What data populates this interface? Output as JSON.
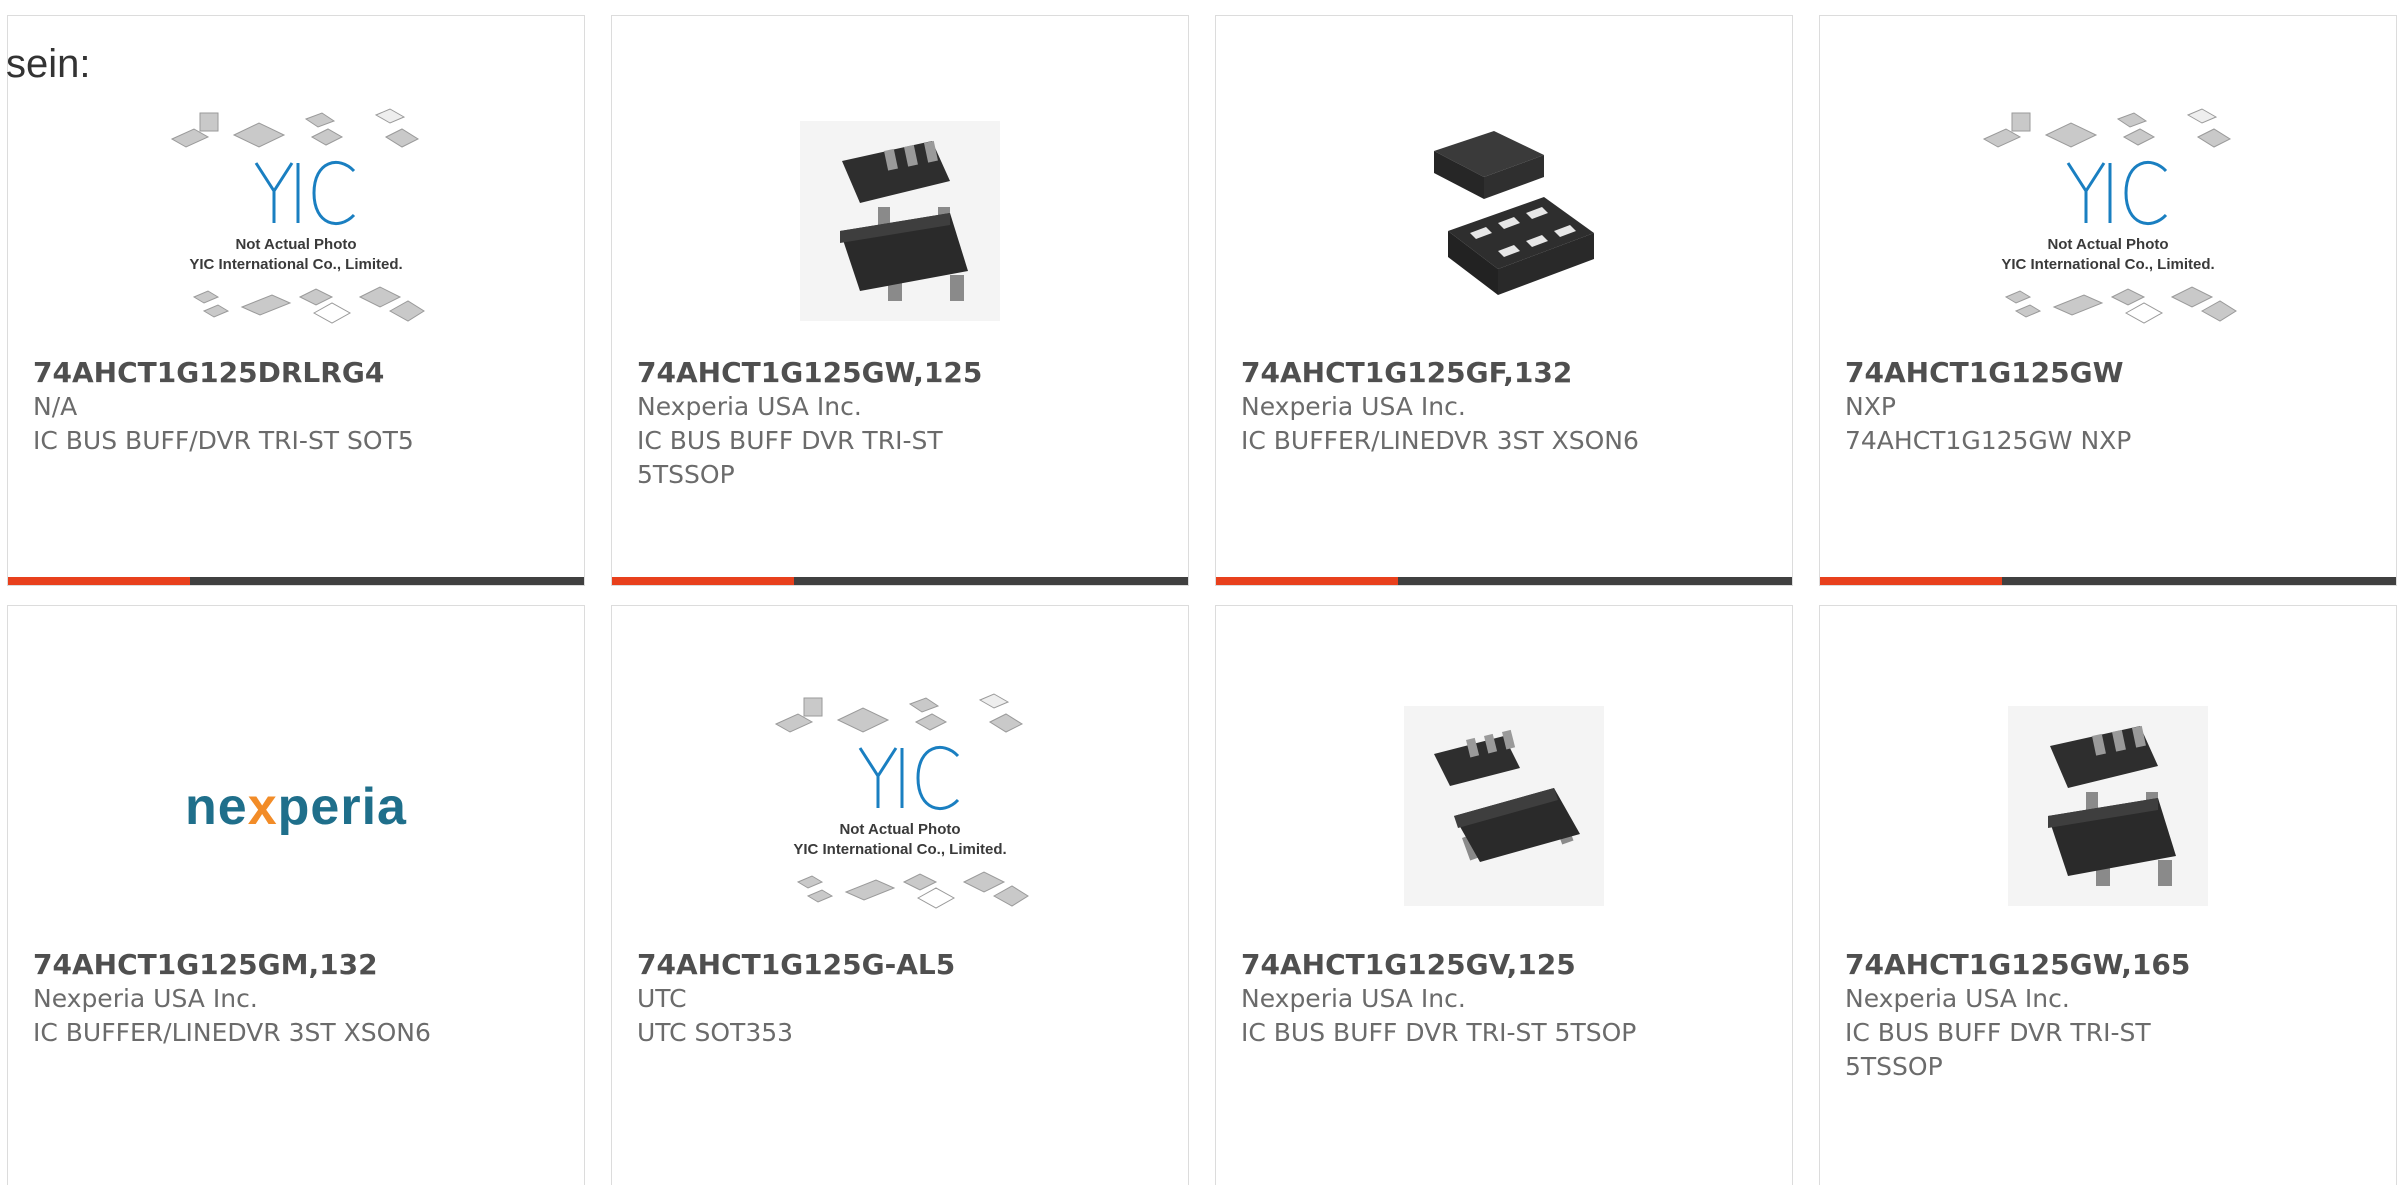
{
  "lead_text": "sein:",
  "products": [
    {
      "part_number": "74AHCT1G125DRLRG4",
      "manufacturer": "N/A",
      "description": "IC BUS BUFF/DVR TRI-ST SOT5",
      "image": "yic-placeholder-image",
      "image_labels": [
        "Not Actual Photo",
        "YIC International Co., Limited."
      ]
    },
    {
      "part_number": "74AHCT1G125GW,125",
      "manufacturer": "Nexperia USA Inc.",
      "description": "IC BUS BUFF DVR TRI-ST 5TSSOP",
      "image": "sot-package-image"
    },
    {
      "part_number": "74AHCT1G125GF,132",
      "manufacturer": "Nexperia USA Inc.",
      "description": "IC BUFFER/LINEDVR 3ST XSON6",
      "image": "xson-package-image"
    },
    {
      "part_number": "74AHCT1G125GW",
      "manufacturer": "NXP",
      "description": "74AHCT1G125GW NXP",
      "image": "yic-placeholder-image",
      "image_labels": [
        "Not Actual Photo",
        "YIC International Co., Limited."
      ]
    },
    {
      "part_number": "74AHCT1G125GM,132",
      "manufacturer": "Nexperia USA Inc.",
      "description": "IC BUFFER/LINEDVR 3ST XSON6",
      "image": "nexperia-logo",
      "logo_text": "nexperia"
    },
    {
      "part_number": "74AHCT1G125G-AL5",
      "manufacturer": "UTC",
      "description": "UTC SOT353",
      "image": "yic-placeholder-image",
      "image_labels": [
        "Not Actual Photo",
        "YIC International Co., Limited."
      ]
    },
    {
      "part_number": "74AHCT1G125GV,125",
      "manufacturer": "Nexperia USA Inc.",
      "description": "IC BUS BUFF DVR TRI-ST 5TSOP",
      "image": "sot-package-image"
    },
    {
      "part_number": "74AHCT1G125GW,165",
      "manufacturer": "Nexperia USA Inc.",
      "description": "IC BUS BUFF DVR TRI-ST 5TSSOP",
      "image": "sot-package-image"
    }
  ],
  "colors": {
    "accent": "#e8401c",
    "bar": "#404040",
    "nexperia_blue": "#1f6f8b",
    "nexperia_orange": "#f28c28",
    "yic_blue": "#1a7fc1"
  }
}
